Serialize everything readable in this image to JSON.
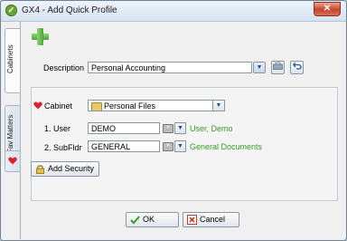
{
  "window": {
    "title": "GX4 - Add Quick Profile",
    "close_label": "✕"
  },
  "tabs": [
    {
      "label": "Cabinets"
    },
    {
      "label": "Fav Matters"
    }
  ],
  "form": {
    "description": {
      "label": "Description",
      "value": "Personal Accounting"
    },
    "cabinet": {
      "label": "Cabinet",
      "value": "Personal Files"
    },
    "user": {
      "label": "1. User",
      "value": "DEMO",
      "hint": "User, Demo"
    },
    "subfldr": {
      "label": "2. SubFldr",
      "value": "GENERAL",
      "hint": "General Documents"
    },
    "add_security": {
      "label": "Add Security"
    }
  },
  "footer": {
    "ok": "OK",
    "cancel": "Cancel"
  },
  "colors": {
    "accent_green": "#3a9a28",
    "close_red": "#c8452b",
    "heart_red": "#d8242a"
  }
}
